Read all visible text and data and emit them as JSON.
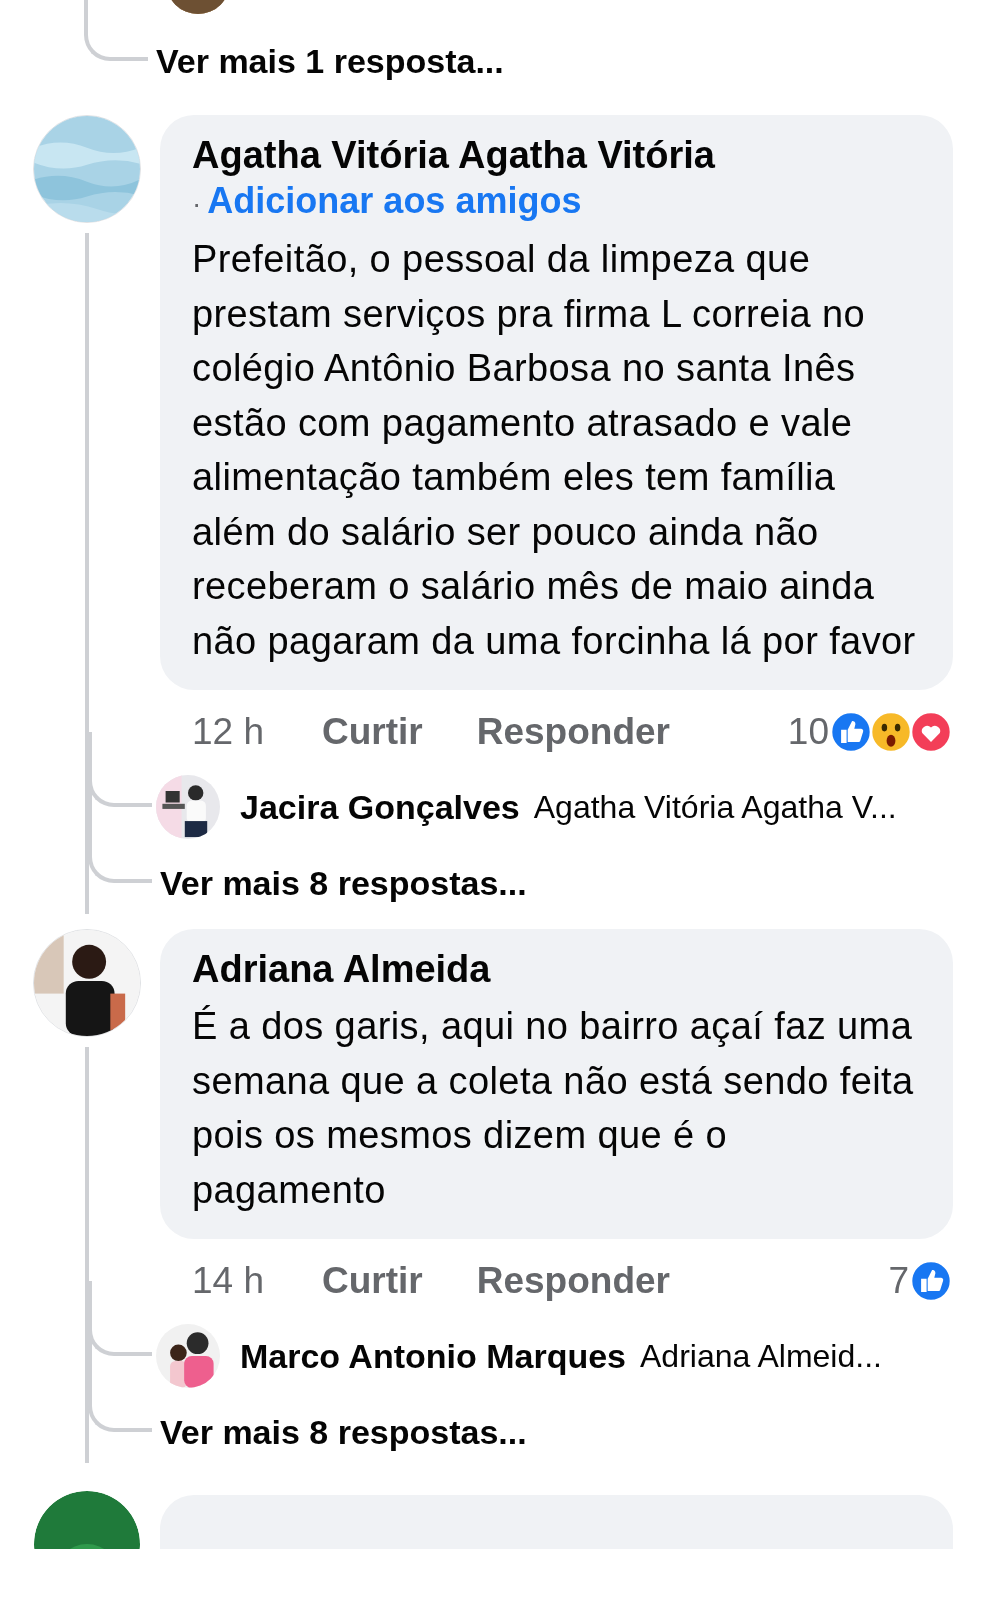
{
  "top_thread": {
    "more_replies": "Ver mais 1 resposta..."
  },
  "comments": [
    {
      "author": "Agatha Vitória Agatha Vitória",
      "separator": "·",
      "add_friend": "Adicionar aos amigos",
      "text": "Prefeitão, o pessoal da limpeza que prestam serviços pra firma L correia no  colégio Antônio Barbosa no santa Inês estão com pagamento atrasado e vale alimentação também eles tem família além do salário ser pouco ainda não receberam o salário mês de maio ainda não pagaram da uma forcinha lá por favor",
      "time": "12 h",
      "like": "Curtir",
      "reply": "Responder",
      "reaction_count": "10",
      "reactions": [
        {
          "kind": "like"
        },
        {
          "kind": "wow"
        },
        {
          "kind": "love"
        }
      ],
      "reply_preview": {
        "author": "Jacira Gonçalves",
        "text": "Agatha Vitória Agatha V..."
      },
      "more_replies": "Ver mais 8 respostas..."
    },
    {
      "author": "Adriana Almeida",
      "text": "É a dos garis, aqui no bairro açaí faz uma semana que a coleta não está sendo feita pois os mesmos dizem que é o pagamento",
      "time": "14 h",
      "like": "Curtir",
      "reply": "Responder",
      "reaction_count": "7",
      "reactions": [
        {
          "kind": "like"
        }
      ],
      "reply_preview": {
        "author": "Marco Antonio Marques",
        "text": "Adriana Almeid..."
      },
      "more_replies": "Ver mais 8 respostas..."
    }
  ]
}
